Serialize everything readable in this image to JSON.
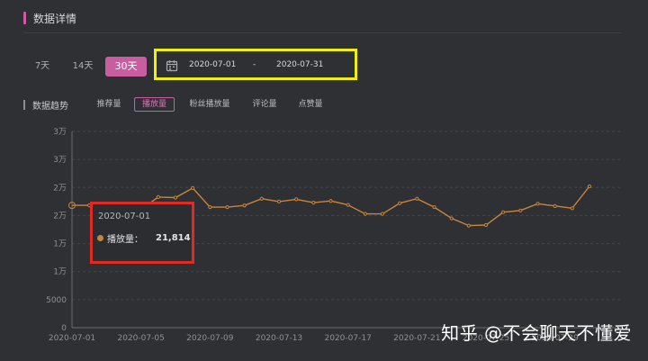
{
  "section": {
    "title": "数据详情"
  },
  "ranges": [
    {
      "label": "7天",
      "active": false
    },
    {
      "label": "14天",
      "active": false
    },
    {
      "label": "30天",
      "active": true
    }
  ],
  "date_picker": {
    "start": "2020-07-01",
    "separator": "-",
    "end": "2020-07-31"
  },
  "trend": {
    "title": "数据趋势",
    "tabs": [
      {
        "label": "推荐量",
        "active": false
      },
      {
        "label": "播放量",
        "active": true
      },
      {
        "label": "粉丝播放量",
        "active": false
      },
      {
        "label": "评论量",
        "active": false
      },
      {
        "label": "点赞量",
        "active": false
      }
    ]
  },
  "tooltip": {
    "date": "2020-07-01",
    "label": "播放量：",
    "value": "21,814"
  },
  "watermark": "知乎 @不会聊天不懂爱",
  "colors": {
    "background": "#2e3033",
    "accent": "#c85e9f",
    "line": "#c9853b",
    "highlight_yellow": "#f1ef10",
    "highlight_red": "#e02a24"
  },
  "chart_data": {
    "type": "line",
    "x": [
      "2020-07-01",
      "2020-07-02",
      "2020-07-03",
      "2020-07-04",
      "2020-07-05",
      "2020-07-06",
      "2020-07-07",
      "2020-07-08",
      "2020-07-09",
      "2020-07-10",
      "2020-07-11",
      "2020-07-12",
      "2020-07-13",
      "2020-07-14",
      "2020-07-15",
      "2020-07-16",
      "2020-07-17",
      "2020-07-18",
      "2020-07-19",
      "2020-07-20",
      "2020-07-21",
      "2020-07-22",
      "2020-07-23",
      "2020-07-24",
      "2020-07-25",
      "2020-07-26",
      "2020-07-27",
      "2020-07-28",
      "2020-07-29",
      "2020-07-30",
      "2020-07-31"
    ],
    "series": [
      {
        "values": [
          21814,
          21814,
          20500,
          20700,
          21100,
          23300,
          23200,
          24900,
          21500,
          21500,
          21800,
          23000,
          22500,
          22900,
          22300,
          22600,
          21900,
          20300,
          20300,
          22200,
          23000,
          21500,
          19500,
          18200,
          18300,
          20600,
          20900,
          22100,
          21700,
          21300,
          25200
        ]
      }
    ],
    "x_tick_labels": [
      "2020-07-01",
      "2020-07-05",
      "2020-07-09",
      "2020-07-13",
      "2020-07-17",
      "2020-07-21",
      "2020-07-25",
      "2020-07-29"
    ],
    "y_ticks": [
      0,
      5000,
      10000,
      15000,
      20000,
      25000,
      30000
    ],
    "y_tick_labels": [
      "0",
      "5000",
      "1万",
      "1万",
      "2万",
      "2万",
      "3万",
      "3万"
    ],
    "ylim": [
      0,
      30000
    ],
    "grid": true,
    "xlabel": "",
    "ylabel": ""
  }
}
